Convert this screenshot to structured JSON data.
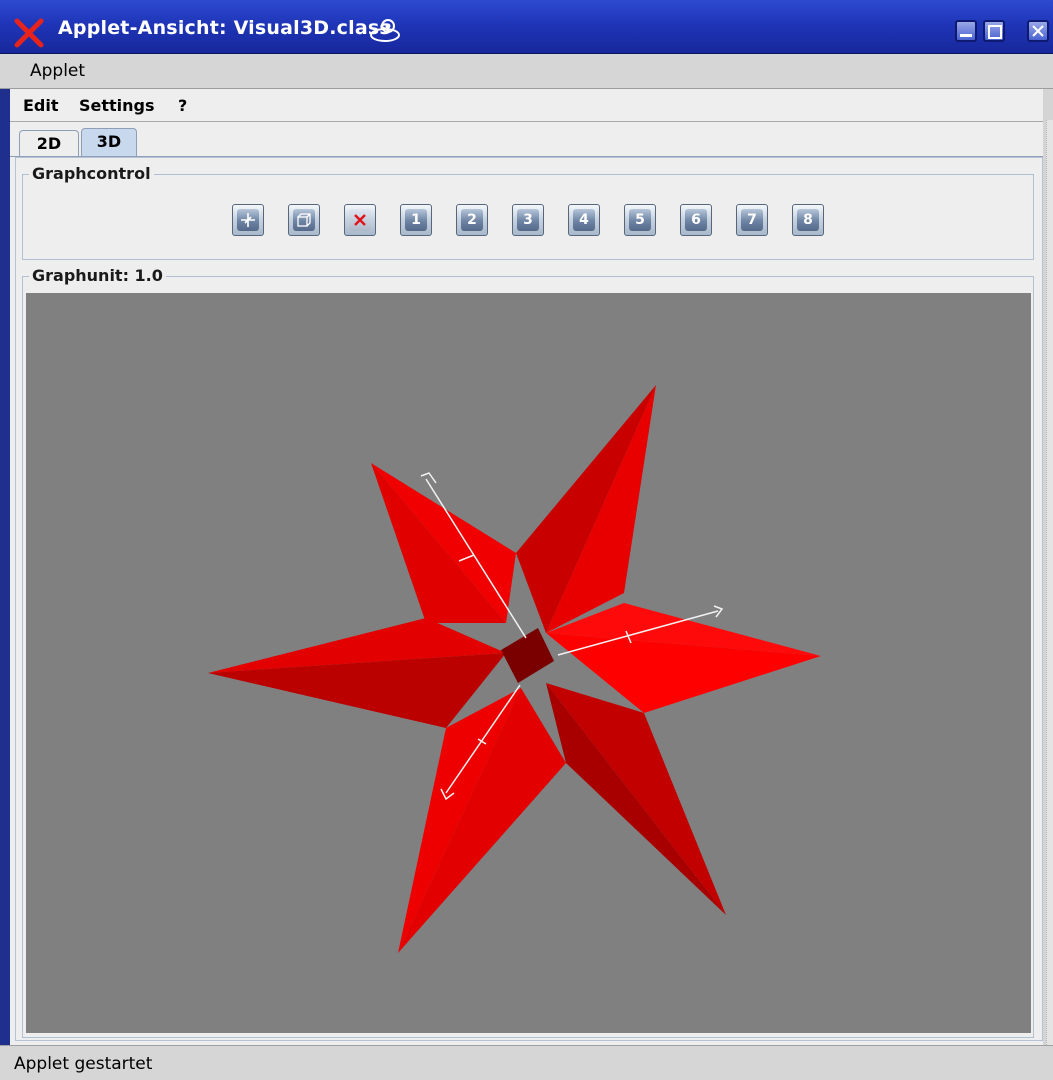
{
  "window": {
    "title": "Applet-Ansicht: Visual3D.class",
    "controls": [
      "minimize",
      "maximize",
      "close"
    ]
  },
  "applet_menu": {
    "label": "Applet"
  },
  "menubar": {
    "items": [
      "Edit",
      "Settings",
      "?"
    ]
  },
  "tabs": [
    {
      "label": "2D",
      "active": false
    },
    {
      "label": "3D",
      "active": true
    }
  ],
  "graphcontrol": {
    "title": "Graphcontrol",
    "buttons": [
      {
        "icon": "axes-icon",
        "label": ""
      },
      {
        "icon": "cube-icon",
        "label": ""
      },
      {
        "icon": "delete-icon",
        "label": ""
      },
      {
        "icon": "number-icon",
        "label": "1"
      },
      {
        "icon": "number-icon",
        "label": "2"
      },
      {
        "icon": "number-icon",
        "label": "3"
      },
      {
        "icon": "number-icon",
        "label": "4"
      },
      {
        "icon": "number-icon",
        "label": "5"
      },
      {
        "icon": "number-icon",
        "label": "6"
      },
      {
        "icon": "number-icon",
        "label": "7"
      },
      {
        "icon": "number-icon",
        "label": "8"
      }
    ]
  },
  "graphunit": {
    "title": "Graphunit: 1.0"
  },
  "canvas": {
    "background": "#808080",
    "shape_color": "#ee0000",
    "shape": "six-pointed 3D star with coordinate axes"
  },
  "status": {
    "text": "Applet gestartet"
  }
}
